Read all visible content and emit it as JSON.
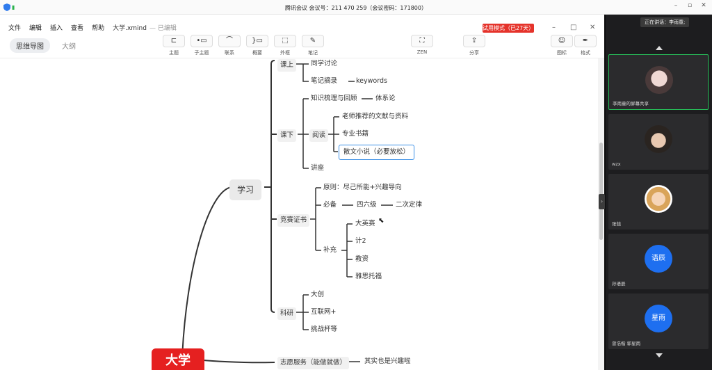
{
  "meeting": {
    "title": "腾讯会议 会议号：211 470 259（会议密码：171800）",
    "speaking": "正在讲话：李雨童;",
    "window_controls": [
      "–",
      "▫",
      "✕"
    ]
  },
  "xmind": {
    "menu": [
      "文件",
      "编辑",
      "插入",
      "查看",
      "帮助"
    ],
    "filename": "大学.xmind",
    "edited_status": "— 已编辑",
    "trial_badge": "试用模式（已27天）",
    "window_controls": [
      "–",
      "□",
      "✕"
    ],
    "mode_tabs": [
      "思维导图",
      "大纲"
    ],
    "tools": [
      {
        "label": "主题",
        "icon": "topic-icon"
      },
      {
        "label": "子主题",
        "icon": "subtopic-icon"
      },
      {
        "label": "联系",
        "icon": "relationship-icon"
      },
      {
        "label": "概要",
        "icon": "summary-icon"
      },
      {
        "label": "外框",
        "icon": "boundary-icon"
      },
      {
        "label": "笔记",
        "icon": "note-icon"
      },
      {
        "label": "ZEN",
        "icon": "zen-icon"
      },
      {
        "label": "分享",
        "icon": "share-icon"
      },
      {
        "label": "图标",
        "icon": "emoji-icon"
      },
      {
        "label": "格式",
        "icon": "format-icon"
      }
    ]
  },
  "mindmap": {
    "root": "大学",
    "main": "学习",
    "branches": {
      "keshang": "课上",
      "tongxue": "同学讨论",
      "biji": "笔记摘录",
      "keywords": "keywords",
      "kexia": "课下",
      "zhishi": "知识梳理与回顾",
      "tixi": "体系论",
      "yuedu": "阅读",
      "laoshi": "老师推荐的文献与资料",
      "zhuanye": "专业书籍",
      "sanwen": "散文小说（必要放松）",
      "jiangzuo": "讲座",
      "jingsai": "竞赛证书",
      "yuanze": "原则：尽己所能+兴趣导向",
      "bibei": "必备",
      "siliuji": "四六级",
      "erci": "二次定律",
      "buchong": "补充",
      "daying": "大英赛",
      "ji2": "计2",
      "jiaozi": "教资",
      "yasi": "雅思托福",
      "keyan": "科研",
      "dachuang": "大创",
      "hulian": "互联网+",
      "tiaozhan": "挑战杯等",
      "zhiyuan": "志愿服务（能做就做）",
      "qishi": "其实也是兴趣啦"
    }
  },
  "participants": [
    {
      "name": "李雨童的屏幕共享",
      "type": "photo"
    },
    {
      "name": "wzx",
      "type": "photo"
    },
    {
      "name": "张喆",
      "type": "photo"
    },
    {
      "name": "孙语辰",
      "avatar_text": "语辰",
      "type": "text"
    },
    {
      "name": "曾浩楷 郭星雨",
      "avatar_text": "星雨",
      "type": "text"
    }
  ],
  "colors": {
    "root": "#e52020",
    "trial": "#e5332b",
    "selection": "#3a8ee6",
    "avatar_blue": "#1e6ff0",
    "active_tile": "#27c05a"
  }
}
